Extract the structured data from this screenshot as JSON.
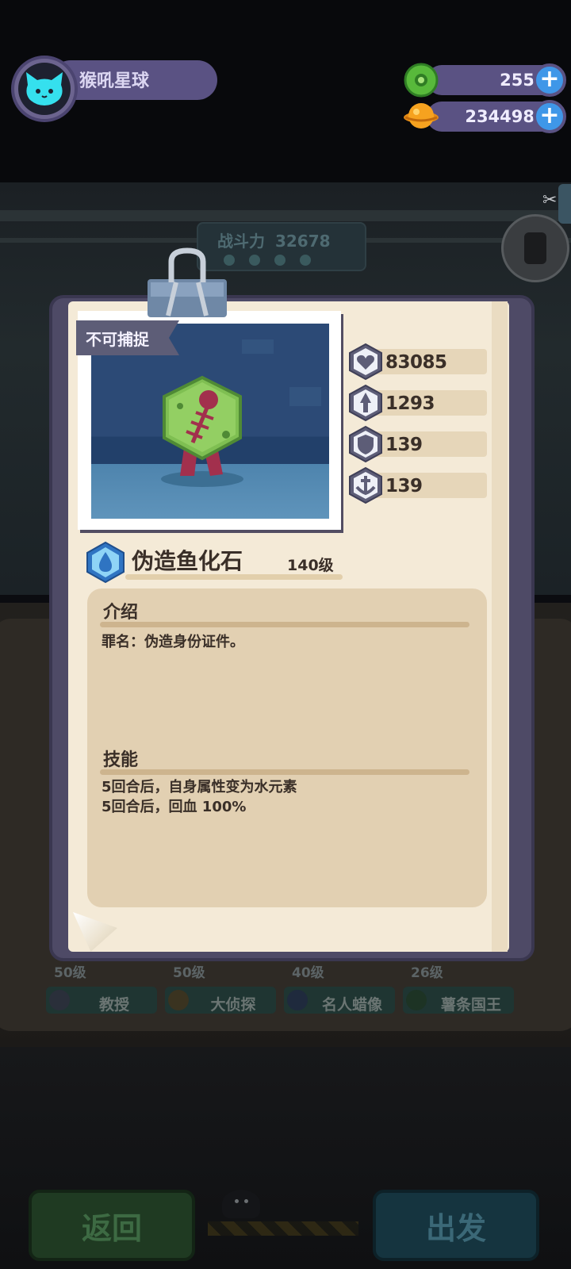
{
  "player": {
    "name": "猴吼星球"
  },
  "resources": [
    {
      "icon": "green-gem-ring-icon",
      "value": "255"
    },
    {
      "icon": "orange-planet-coin-icon",
      "value": "234498"
    }
  ],
  "background": {
    "combat_power_label": "战斗力",
    "combat_power_value": "32678",
    "team": [
      {
        "level": "50级",
        "name": "教授"
      },
      {
        "level": "50级",
        "name": "大侦探"
      },
      {
        "level": "40级",
        "name": "名人蜡像"
      },
      {
        "level": "26级",
        "name": "薯条国王"
      }
    ],
    "back_button": "返回",
    "go_button": "出发"
  },
  "card": {
    "flag": "不可捕捉",
    "stats": [
      {
        "icon": "heart-hp-icon",
        "value": "83085"
      },
      {
        "icon": "attack-arrow-icon",
        "value": "1293"
      },
      {
        "icon": "shield-defense-icon",
        "value": "139"
      },
      {
        "icon": "speed-wing-icon",
        "value": "139"
      }
    ],
    "element_icon": "water-drop-icon",
    "name": "伪造鱼化石",
    "level": "140级",
    "intro_title": "介绍",
    "intro_text": "罪名：伪造身份证件。",
    "skills_title": "技能",
    "skills": [
      "5回合后，自身属性变为水元素",
      "5回合后，回血 100%"
    ]
  },
  "colors": {
    "paper": "#f4ead7",
    "card_frame": "#4e4a66",
    "hud_bar": "#5a5283",
    "plus_button": "#3f97e8",
    "info_box": "#e2d0b2"
  }
}
